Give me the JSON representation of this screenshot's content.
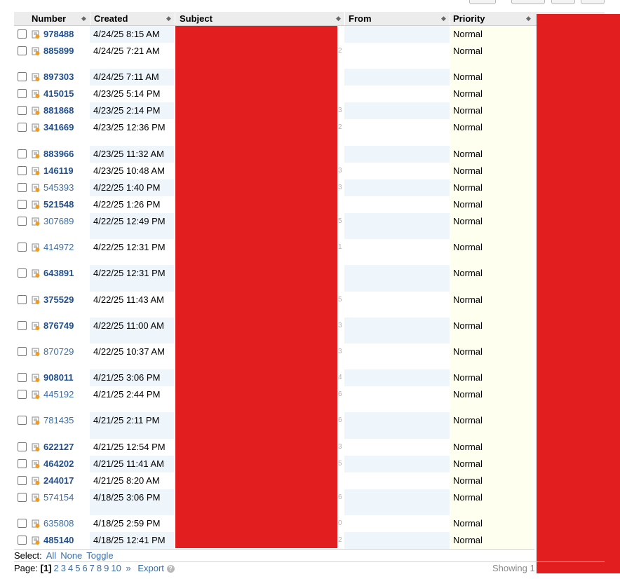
{
  "columns": {
    "number": "Number",
    "created": "Created",
    "subject": "Subject",
    "from": "From",
    "priority": "Priority"
  },
  "rows": [
    {
      "number": "978488",
      "created": "4/24/25 8:15 AM",
      "thread": "",
      "priority": "Normal",
      "unread": false
    },
    {
      "number": "885899",
      "created": "4/24/25 7:21 AM",
      "thread": "2",
      "priority": "Normal",
      "unread": false
    },
    {
      "number": "897303",
      "created": "4/24/25 7:11 AM",
      "thread": "",
      "priority": "Normal",
      "unread": false
    },
    {
      "number": "415015",
      "created": "4/23/25 5:14 PM",
      "thread": "",
      "priority": "Normal",
      "unread": false
    },
    {
      "number": "881868",
      "created": "4/23/25 2:14 PM",
      "thread": "3",
      "priority": "Normal",
      "unread": false
    },
    {
      "number": "341669",
      "created": "4/23/25 12:36 PM",
      "thread": "2",
      "priority": "Normal",
      "unread": false
    },
    {
      "number": "883966",
      "created": "4/23/25 11:32 AM",
      "thread": "",
      "priority": "Normal",
      "unread": false
    },
    {
      "number": "146119",
      "created": "4/23/25 10:48 AM",
      "thread": "3",
      "priority": "Normal",
      "unread": false
    },
    {
      "number": "545393",
      "created": "4/22/25 1:40 PM",
      "thread": "3",
      "priority": "Normal",
      "unread": true
    },
    {
      "number": "521548",
      "created": "4/22/25 1:26 PM",
      "thread": "",
      "priority": "Normal",
      "unread": false
    },
    {
      "number": "307689",
      "created": "4/22/25 12:49 PM",
      "thread": "5",
      "priority": "Normal",
      "unread": true
    },
    {
      "number": "414972",
      "created": "4/22/25 12:31 PM",
      "thread": "1",
      "priority": "Normal",
      "unread": true
    },
    {
      "number": "643891",
      "created": "4/22/25 12:31 PM",
      "thread": "",
      "priority": "Normal",
      "unread": false
    },
    {
      "number": "375529",
      "created": "4/22/25 11:43 AM",
      "thread": "5",
      "priority": "Normal",
      "unread": false
    },
    {
      "number": "876749",
      "created": "4/22/25 11:00 AM",
      "thread": "3",
      "priority": "Normal",
      "unread": false
    },
    {
      "number": "870729",
      "created": "4/22/25 10:37 AM",
      "thread": "3",
      "priority": "Normal",
      "unread": true
    },
    {
      "number": "908011",
      "created": "4/21/25 3:06 PM",
      "thread": "4",
      "priority": "Normal",
      "unread": false
    },
    {
      "number": "445192",
      "created": "4/21/25 2:44 PM",
      "thread": "6",
      "priority": "Normal",
      "unread": true
    },
    {
      "number": "781435",
      "created": "4/21/25 2:11 PM",
      "thread": "6",
      "priority": "Normal",
      "unread": true
    },
    {
      "number": "622127",
      "created": "4/21/25 12:54 PM",
      "thread": "3",
      "priority": "Normal",
      "unread": false
    },
    {
      "number": "464202",
      "created": "4/21/25 11:41 AM",
      "thread": "5",
      "priority": "Normal",
      "unread": false
    },
    {
      "number": "244017",
      "created": "4/21/25 8:20 AM",
      "thread": "",
      "priority": "Normal",
      "unread": false
    },
    {
      "number": "574154",
      "created": "4/18/25 3:06 PM",
      "thread": "6",
      "priority": "Normal",
      "unread": true
    },
    {
      "number": "635808",
      "created": "4/18/25 2:59 PM",
      "thread": "0",
      "priority": "Normal",
      "unread": true
    },
    {
      "number": "485140",
      "created": "4/18/25 12:41 PM",
      "thread": "2",
      "priority": "Normal",
      "unread": false
    }
  ],
  "select_bar": {
    "label": "Select:",
    "all": "All",
    "none": "None",
    "toggle": "Toggle"
  },
  "pagination": {
    "label": "Page:",
    "current": "[1]",
    "pages": [
      "2",
      "3",
      "4",
      "5",
      "6",
      "7",
      "8",
      "9",
      "10"
    ],
    "next": "»",
    "export": "Export",
    "help_glyph": "?"
  },
  "showing_text": "Showing 1",
  "icons": {
    "ticket": "ticket-icon",
    "sort": "sort-arrows-icon"
  },
  "colors": {
    "link": "#3b6ea8",
    "link_bold": "#1f4f8f",
    "redaction": "#e31e1f",
    "alt_row": "#eef6fc",
    "priority_bg": "#fffff0"
  }
}
